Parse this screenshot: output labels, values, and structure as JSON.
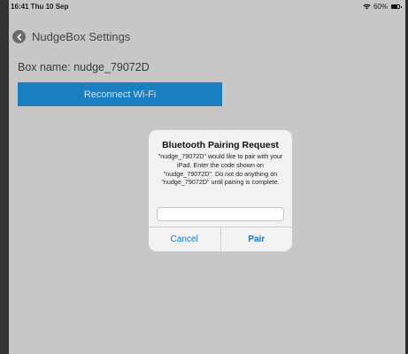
{
  "status_bar": {
    "time_date": "16:41  Thu 10 Sep",
    "battery": "60%",
    "icons": [
      "wifi-icon",
      "battery-icon"
    ]
  },
  "nav": {
    "title": "NudgeBox Settings",
    "back_icon": "chevron-left-icon"
  },
  "settings": {
    "box_name": "Box name: nudge_79072D",
    "reconnect_label": "Reconnect Wi-Fi"
  },
  "alert": {
    "title": "Bluetooth Pairing Request",
    "message": "\"nudge_79072D\" would like to pair with your iPad. Enter the code shown on \"nudge_79072D\". Do not do anything on \"nudge_79072D\" until pairing is complete.",
    "input_value": "",
    "cancel_label": "Cancel",
    "pair_label": "Pair"
  },
  "colors": {
    "background": "#c7c7c7",
    "accent": "#1a7fc1",
    "alert_link": "#1479d6"
  }
}
